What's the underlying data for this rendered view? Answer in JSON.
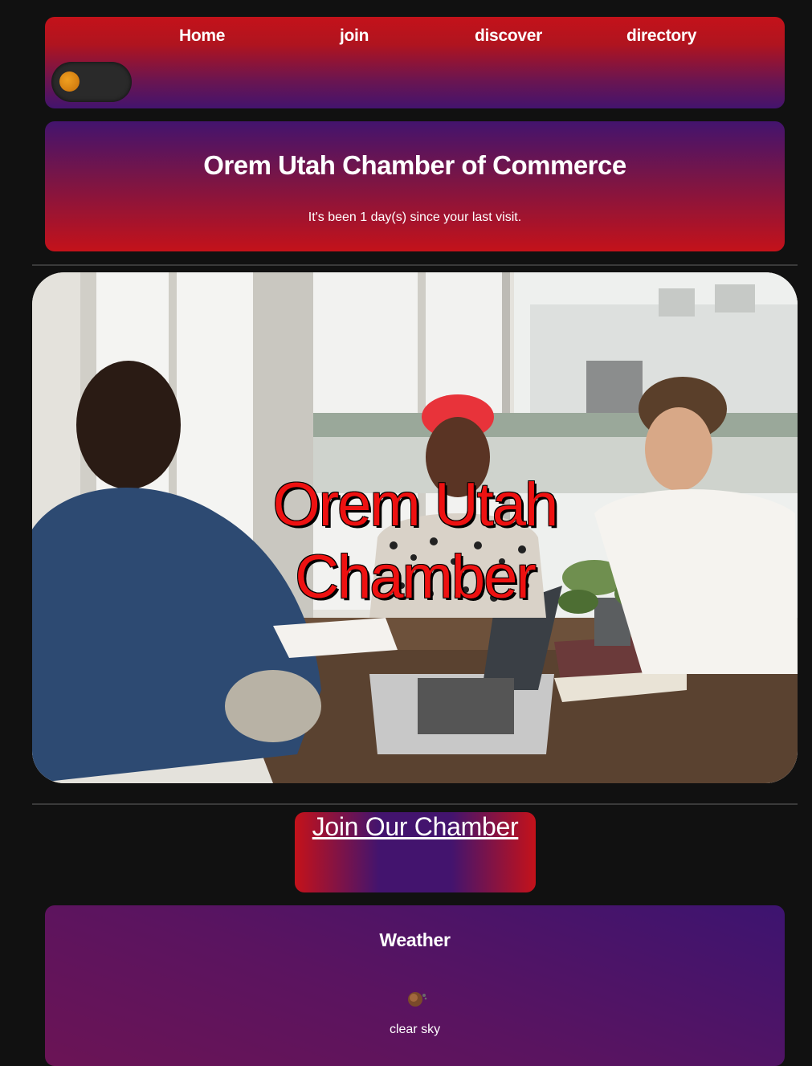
{
  "nav": {
    "items": [
      {
        "label": "Home"
      },
      {
        "label": "join"
      },
      {
        "label": "discover"
      },
      {
        "label": "directory"
      }
    ]
  },
  "header": {
    "title": "Orem Utah Chamber of Commerce",
    "visit_message": "It's been 1 day(s) since your last visit."
  },
  "hero": {
    "line1": "Orem Utah",
    "line2": "Chamber"
  },
  "join": {
    "label": "Join Our Chamber"
  },
  "weather": {
    "title": "Weather",
    "description": "clear sky",
    "icon": "clear-sky-icon"
  },
  "colors": {
    "brand_red": "#c4121a",
    "brand_purple": "#43146e",
    "page_background": "#111111",
    "hero_text": "#ee1111"
  }
}
